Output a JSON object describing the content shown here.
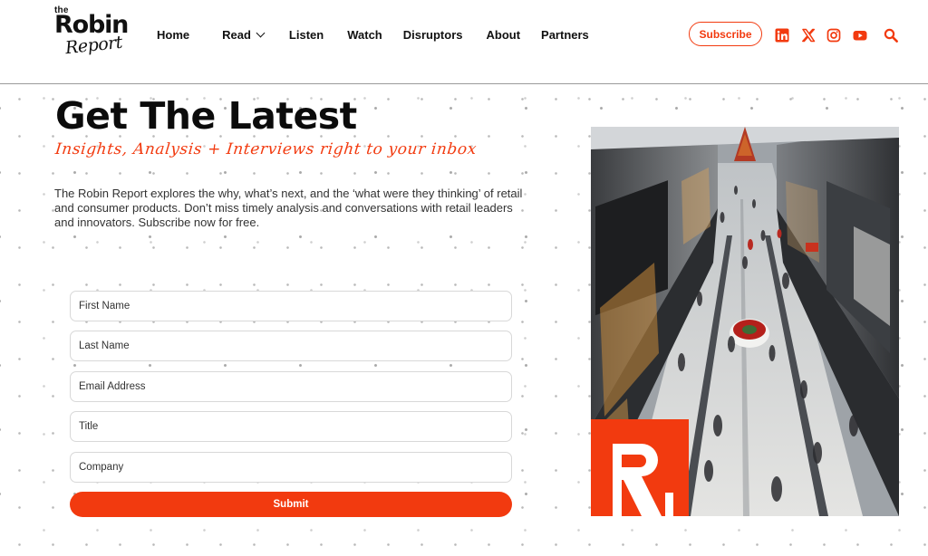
{
  "header": {
    "logo": {
      "small": "the",
      "main": "Robin",
      "script": "Report"
    },
    "nav": [
      {
        "label": "Home",
        "dropdown": false
      },
      {
        "label": "Read",
        "dropdown": true
      },
      {
        "label": "Listen",
        "dropdown": false
      },
      {
        "label": "Watch",
        "dropdown": false
      },
      {
        "label": "Disruptors",
        "dropdown": false
      },
      {
        "label": "About",
        "dropdown": false
      },
      {
        "label": "Partners",
        "dropdown": false
      }
    ],
    "subscribe_label": "Subscribe",
    "social_icons": [
      "linkedin-icon",
      "x-icon",
      "instagram-icon",
      "youtube-icon",
      "search-icon"
    ]
  },
  "hero": {
    "headline": "Get The Latest",
    "tagline": "Insights, Analysis + Interviews right to your inbox",
    "intro": "The Robin Report explores the why, what’s next, and the ‘what were they thinking’ of retail and consumer products. Don’t miss timely analysis and conversations with retail leaders and innovators. Subscribe now for free."
  },
  "form": {
    "first_name": {
      "placeholder": "First Name",
      "value": ""
    },
    "last_name": {
      "placeholder": "Last Name",
      "value": ""
    },
    "email": {
      "placeholder": "Email Address",
      "value": ""
    },
    "title": {
      "placeholder": "Title",
      "value": ""
    },
    "company": {
      "placeholder": "Company",
      "value": ""
    },
    "submit_label": "Submit"
  },
  "colors": {
    "accent": "#f23a0f",
    "text": "#111111",
    "border": "#d8d8d8"
  }
}
